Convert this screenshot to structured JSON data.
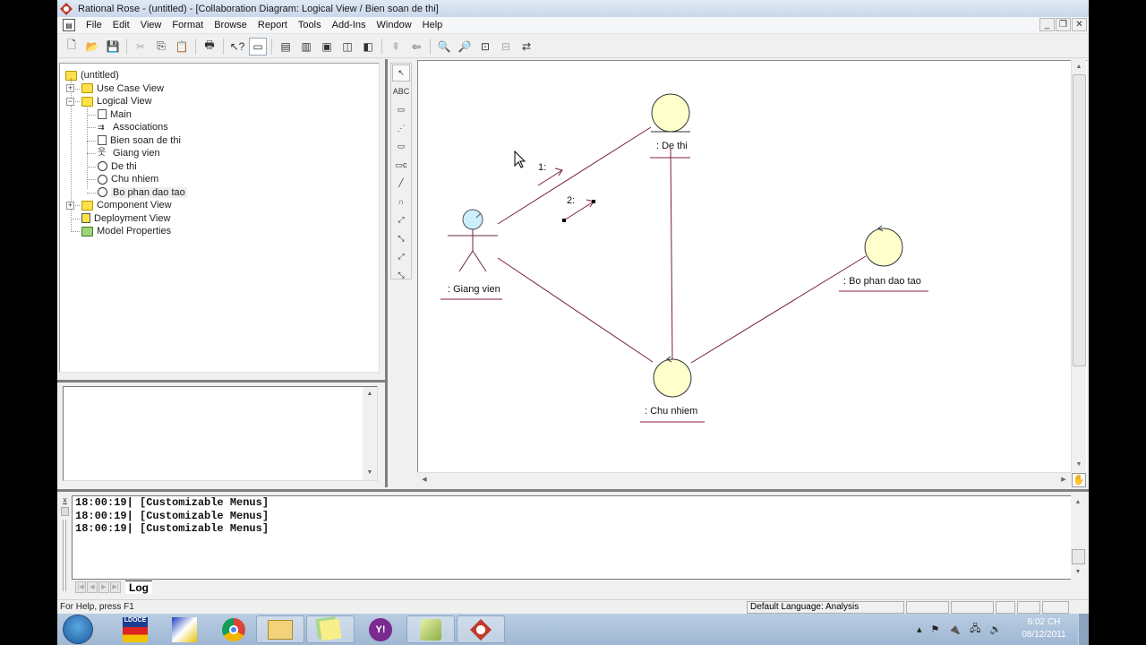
{
  "window": {
    "title": "Rational Rose - (untitled) - [Collaboration Diagram: Logical View / Bien soan de thi]"
  },
  "menu": [
    "File",
    "Edit",
    "View",
    "Format",
    "Browse",
    "Report",
    "Tools",
    "Add-Ins",
    "Window",
    "Help"
  ],
  "mdi_buttons": {
    "minimize": "_",
    "restore": "❐",
    "close": "✕"
  },
  "toolbar": [
    {
      "name": "new-icon",
      "glyph": "🗋"
    },
    {
      "name": "open-icon",
      "glyph": "📂"
    },
    {
      "name": "save-icon",
      "glyph": "💾"
    },
    {
      "sep": true
    },
    {
      "name": "cut-icon",
      "glyph": "✂",
      "disabled": true
    },
    {
      "name": "copy-icon",
      "glyph": "⎘"
    },
    {
      "name": "paste-icon",
      "glyph": "📋",
      "disabled": true
    },
    {
      "sep": true
    },
    {
      "name": "print-icon",
      "glyph": "🖶"
    },
    {
      "sep": true
    },
    {
      "name": "context-help-icon",
      "glyph": "↖?"
    },
    {
      "name": "view-docs-icon",
      "glyph": "▭",
      "active": true
    },
    {
      "sep": true
    },
    {
      "name": "browse-class-diagram-icon",
      "glyph": "▤"
    },
    {
      "name": "browse-interaction-diagram-icon",
      "glyph": "▥"
    },
    {
      "name": "browse-component-diagram-icon",
      "glyph": "▣"
    },
    {
      "name": "browse-state-diagram-icon",
      "glyph": "◫"
    },
    {
      "name": "browse-deployment-diagram-icon",
      "glyph": "◧"
    },
    {
      "sep": true
    },
    {
      "name": "browse-parent-icon",
      "glyph": "⇞",
      "disabled": true
    },
    {
      "name": "browse-previous-icon",
      "glyph": "⇦"
    },
    {
      "sep": true
    },
    {
      "name": "zoom-in-icon",
      "glyph": "🔍",
      "disabled": true
    },
    {
      "name": "zoom-out-icon",
      "glyph": "🔎"
    },
    {
      "name": "fit-in-window-icon",
      "glyph": "⊡"
    },
    {
      "name": "undo-fit-icon",
      "glyph": "⊟",
      "disabled": true
    },
    {
      "name": "switch-diagram-icon",
      "glyph": "⇄"
    }
  ],
  "browser": {
    "root": "(untitled)",
    "items": [
      {
        "label": "Use Case View",
        "type": "folder",
        "level": 1,
        "expander": "+"
      },
      {
        "label": "Logical View",
        "type": "folder",
        "level": 1,
        "expander": "−"
      },
      {
        "label": "Main",
        "type": "class-diagram",
        "level": 2
      },
      {
        "label": "Associations",
        "type": "associations",
        "level": 2
      },
      {
        "label": "Bien soan de thi",
        "type": "collaboration-diagram",
        "level": 2
      },
      {
        "label": "Giang vien",
        "type": "actor",
        "level": 2
      },
      {
        "label": "De thi",
        "type": "entity",
        "level": 2
      },
      {
        "label": "Chu nhiem",
        "type": "control",
        "level": 2
      },
      {
        "label": "Bo phan dao tao",
        "type": "control",
        "level": 2,
        "selected": true
      },
      {
        "label": "Component View",
        "type": "folder",
        "level": 1,
        "expander": "+"
      },
      {
        "label": "Deployment View",
        "type": "deployment",
        "level": 1
      },
      {
        "label": "Model Properties",
        "type": "properties",
        "level": 1
      }
    ]
  },
  "palette": [
    {
      "name": "selection-tool-icon",
      "glyph": "↖",
      "active": true
    },
    {
      "name": "text-box-tool-icon",
      "glyph": "ABC"
    },
    {
      "name": "note-tool-icon",
      "glyph": "▭"
    },
    {
      "name": "anchor-note-tool-icon",
      "glyph": "⋰"
    },
    {
      "name": "object-tool-icon",
      "glyph": "▭"
    },
    {
      "name": "class-instance-tool-icon",
      "glyph": "▭c"
    },
    {
      "name": "object-link-tool-icon",
      "glyph": "╱"
    },
    {
      "name": "link-to-self-tool-icon",
      "glyph": "∩"
    },
    {
      "name": "link-message-tool-icon",
      "glyph": "⤢"
    },
    {
      "name": "reverse-link-message-tool-icon",
      "glyph": "⤡"
    },
    {
      "name": "data-token-tool-icon",
      "glyph": "⤢"
    },
    {
      "name": "reverse-data-token-tool-icon",
      "glyph": "⤡"
    }
  ],
  "diagram": {
    "objects": [
      {
        "id": "giang-vien",
        "label": ": Giang vien",
        "kind": "actor"
      },
      {
        "id": "de-thi",
        "label": ": De thi",
        "kind": "entity"
      },
      {
        "id": "chu-nhiem",
        "label": ": Chu nhiem",
        "kind": "control"
      },
      {
        "id": "bo-phan-dao-tao",
        "label": ": Bo phan dao tao",
        "kind": "control"
      }
    ],
    "links": [
      {
        "from": "giang-vien",
        "to": "de-thi"
      },
      {
        "from": "giang-vien",
        "to": "chu-nhiem"
      },
      {
        "from": "de-thi",
        "to": "chu-nhiem"
      },
      {
        "from": "chu-nhiem",
        "to": "bo-phan-dao-tao"
      }
    ],
    "messages": [
      {
        "label": "1:",
        "selected": false
      },
      {
        "label": "2:",
        "selected": true
      }
    ],
    "colors": {
      "object_fill": "#ffffcc",
      "actor_fill": "#cdeefd",
      "link": "#7a1f3d",
      "underline": "#8b1c3c"
    }
  },
  "log": {
    "lines": [
      "18:00:19|  [Customizable Menus]",
      "18:00:19|  [Customizable Menus]",
      "18:00:19|  [Customizable Menus]"
    ],
    "tab": "Log"
  },
  "status": {
    "help": "For Help, press F1",
    "language": "Default Language: Analysis"
  },
  "taskbar": {
    "apps": [
      "start-button",
      "ldoce-app",
      "pinned-app",
      "chrome-app",
      "explorer-app",
      "sticky-notes-app",
      "yahoo-messenger-app",
      "app-green",
      "rational-rose-app"
    ],
    "ldoce_label": "LDOCE",
    "clock_time": "6:02 CH",
    "clock_date": "08/12/2011"
  }
}
